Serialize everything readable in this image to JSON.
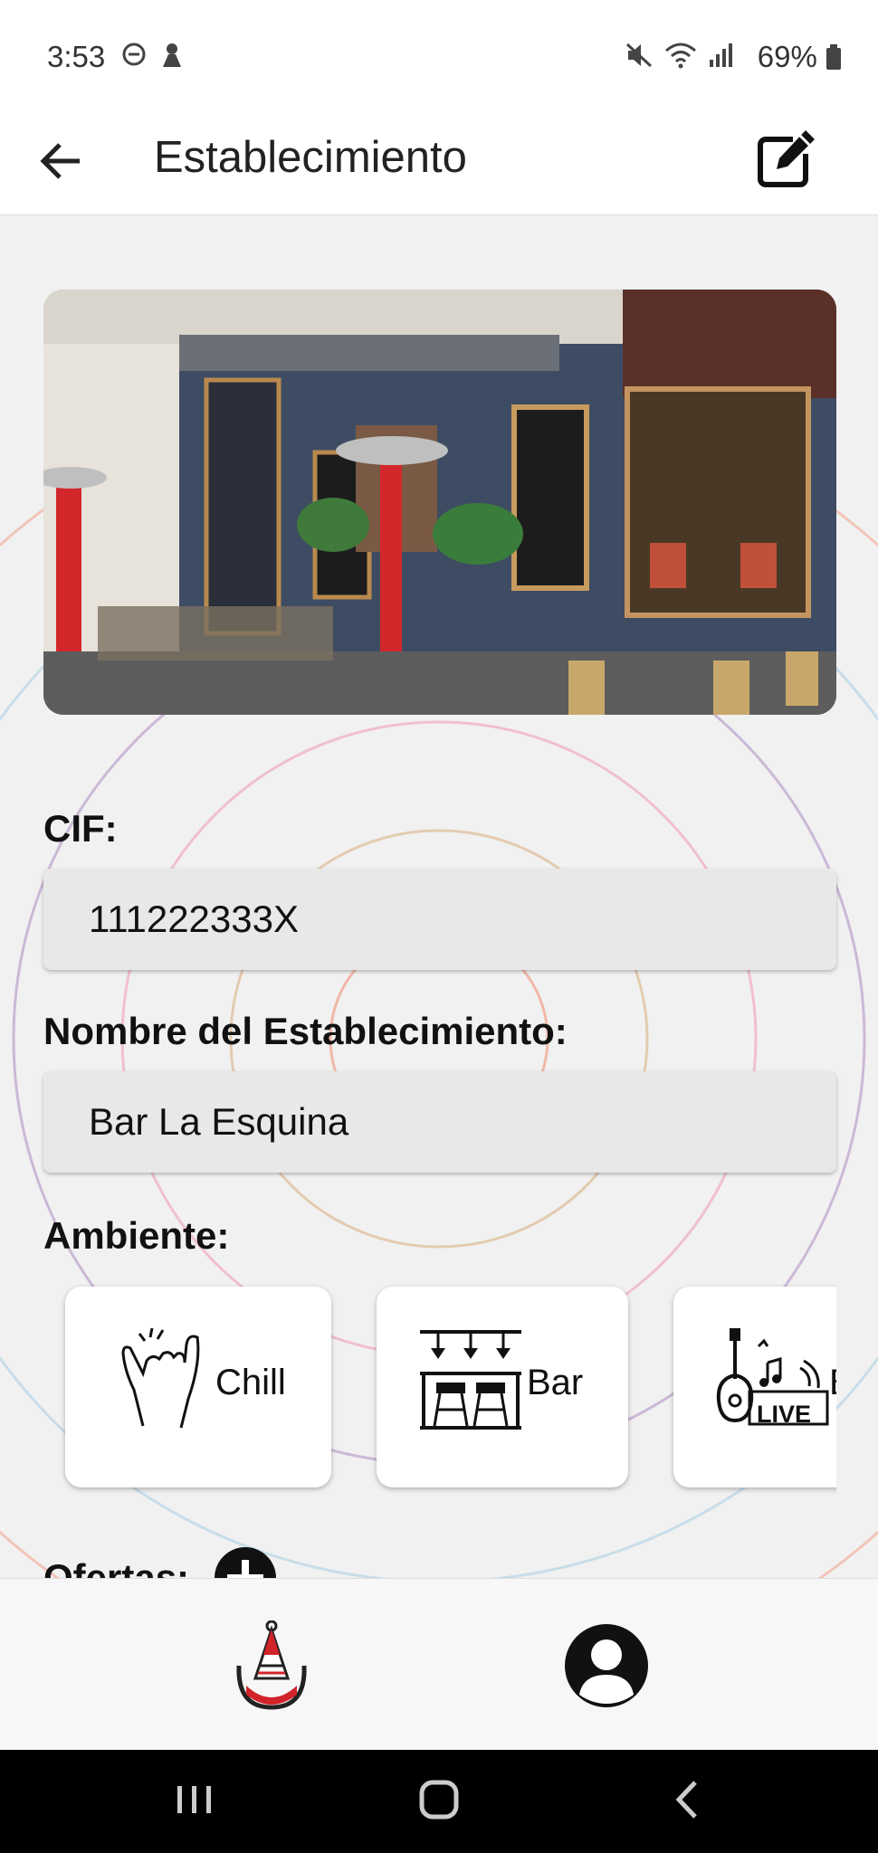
{
  "status_bar": {
    "time": "3:53",
    "battery": "69%",
    "icons": [
      "do-not-disturb-icon",
      "notification-icon",
      "mute-icon",
      "wifi-icon",
      "signal-icon",
      "battery-icon"
    ]
  },
  "app_bar": {
    "title": "Establecimiento",
    "back_icon": "arrow-left-icon",
    "edit_icon": "edit-icon"
  },
  "hero_image": {
    "description_icon": "bar-storefront-photo"
  },
  "form": {
    "cif_label": "CIF:",
    "cif_value": "111222333X",
    "name_label": "Nombre del Establecimiento:",
    "name_value": "Bar La Esquina",
    "ambiente_label": "Ambiente:",
    "ambientes": [
      {
        "label": "Chill",
        "icon": "shaka-hand-icon"
      },
      {
        "label": "Bar",
        "icon": "bar-stools-icon"
      },
      {
        "label": "B",
        "icon": "live-music-icon"
      }
    ],
    "live_badge": "LIVE",
    "ofertas_label": "Ofertas:",
    "add_icon": "plus-circle-icon"
  },
  "bottom_nav": {
    "items": [
      {
        "name": "home",
        "icon": "party-hat-logo-icon"
      },
      {
        "name": "profile",
        "icon": "user-avatar-icon"
      }
    ]
  },
  "colors": {
    "background": "#f1f1f1",
    "field_bg": "#e8e8e8",
    "logo_red": "#d1232a",
    "logo_dark": "#222222"
  }
}
